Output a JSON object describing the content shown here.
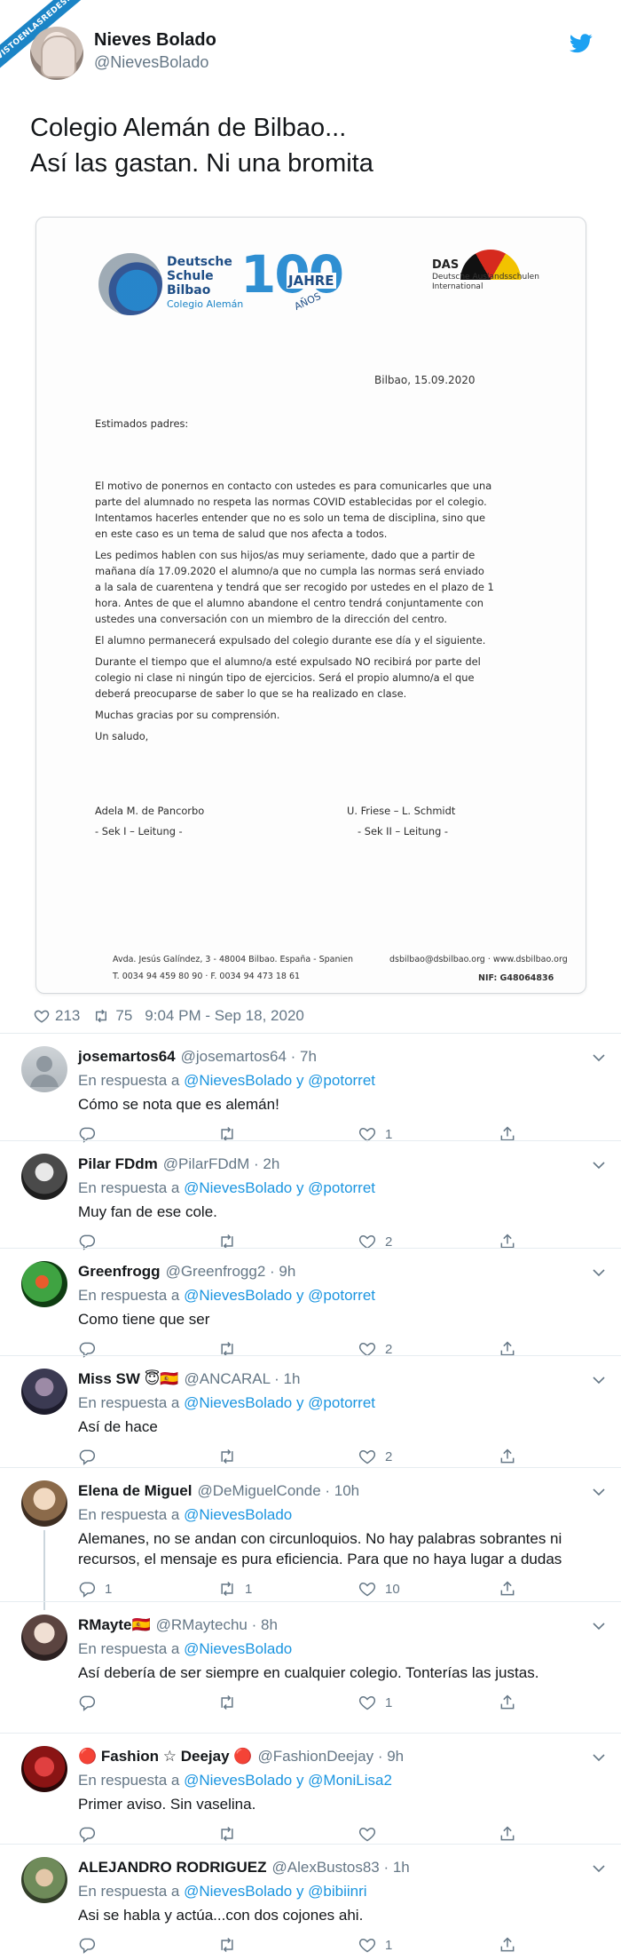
{
  "watermark": "VISTOENLASREDES.COM",
  "tweet": {
    "author_name": "Nieves Bolado",
    "author_handle": "@NievesBolado",
    "text_lines": [
      "Colegio Alemán de Bilbao...",
      "Así las gastan. Ni una bromita"
    ],
    "likes": "213",
    "retweets": "75",
    "timestamp": "9:04 PM - Sep 18, 2020"
  },
  "letter": {
    "school_lines": [
      "Deutsche",
      "Schule",
      "Bilbao"
    ],
    "school_sub": "Colegio Alemán",
    "jubilee_number": "100",
    "jubilee_word": "JAHRE",
    "jubilee_sub": "AÑOS",
    "das_title": "DAS",
    "das_sub_lines": [
      "Deutsche Auslandsschulen",
      "International"
    ],
    "date": "Bilbao, 15.09.2020",
    "greeting": "Estimados padres:",
    "paragraph_lines": [
      "El motivo de ponernos en contacto con ustedes es para comunicarles que una",
      "parte del alumnado no respeta las normas COVID establecidas por el colegio.",
      "Intentamos hacerles entender que no es solo un tema de disciplina, sino que",
      "en este caso es un tema de salud que nos afecta a todos.",
      "Les pedimos hablen con sus hijos/as muy seriamente, dado que a partir de",
      "mañana día 17.09.2020 el alumno/a que no cumpla las normas será enviado",
      "a la sala de cuarentena y tendrá que ser recogido por ustedes en el plazo de 1",
      "hora. Antes de que el alumno abandone el centro tendrá conjuntamente con",
      "ustedes una conversación con un miembro de la dirección del centro.",
      "El alumno permanecerá expulsado del colegio durante ese día y el siguiente.",
      "Durante el tiempo que el alumno/a esté expulsado NO recibirá por parte del",
      "colegio ni clase ni ningún tipo de ejercicios. Será el propio alumno/a el que",
      "deberá preocuparse de saber lo que se ha realizado en clase.",
      "Muchas gracias por su comprensión.",
      "Un saludo,"
    ],
    "signer_left_name": "Adela M. de Pancorbo",
    "signer_left_role": "- Sek I – Leitung -",
    "signer_right_name": "U. Friese – L. Schmidt",
    "signer_right_role": "- Sek II – Leitung -",
    "footer_address": "Avda. Jesús Galíndez, 3 - 48004 Bilbao. España - Spanien",
    "footer_phones": "T. 0034 94 459 80 90 · F. 0034 94 473 18 61",
    "footer_web": "dsbilbao@dsbilbao.org · www.dsbilbao.org",
    "footer_nif": "NIF: G48064836"
  },
  "replies": [
    {
      "name": "josemartos64",
      "handle": "@josemartos64 · 7h",
      "in_reply_prefix": "En respuesta a ",
      "mentions": "@NievesBolado y @potorret",
      "text": "Cómo se nota que es alemán!",
      "reply_count": "",
      "retweet_count": "",
      "like_count": "1"
    },
    {
      "name": "Pilar FDdm",
      "handle": "@PilarFDdM · 2h",
      "in_reply_prefix": "En respuesta a ",
      "mentions": "@NievesBolado y @potorret",
      "text": "Muy fan de ese cole.",
      "reply_count": "",
      "retweet_count": "",
      "like_count": "2"
    },
    {
      "name": "Greenfrogg",
      "handle": "@Greenfrogg2 · 9h",
      "in_reply_prefix": "En respuesta a ",
      "mentions": "@NievesBolado y @potorret",
      "text": "Como tiene que ser",
      "reply_count": "",
      "retweet_count": "",
      "like_count": "2"
    },
    {
      "name": "Miss SW 😇🇪🇸",
      "handle": "@ANCARAL · 1h",
      "in_reply_prefix": "En respuesta a ",
      "mentions": "@NievesBolado y @potorret",
      "text": "Así de hace",
      "reply_count": "",
      "retweet_count": "",
      "like_count": "2"
    },
    {
      "name": "Elena de Miguel",
      "handle": "@DeMiguelConde · 10h",
      "in_reply_prefix": "En respuesta a ",
      "mentions": "@NievesBolado",
      "text": "Alemanes, no se andan con circunloquios. No hay palabras sobrantes ni recursos, el mensaje es pura eficiencia. Para que no haya lugar a dudas",
      "reply_count": "1",
      "retweet_count": "1",
      "like_count": "10"
    },
    {
      "name": "RMayte🇪🇸",
      "handle": "@RMaytechu · 8h",
      "in_reply_prefix": "En respuesta a ",
      "mentions": "@NievesBolado",
      "text": "Así debería de ser siempre en cualquier colegio. Tonterías las justas.",
      "reply_count": "",
      "retweet_count": "",
      "like_count": "1"
    },
    {
      "name": "🔴 Fashion ☆ Deejay 🔴",
      "handle": "@FashionDeejay · 9h",
      "in_reply_prefix": "En respuesta a ",
      "mentions": "@NievesBolado y @MoniLisa2",
      "text": "Primer aviso. Sin vaselina.",
      "reply_count": "",
      "retweet_count": "",
      "like_count": ""
    },
    {
      "name": "ALEJANDRO RODRIGUEZ",
      "handle": "@AlexBustos83 · 1h",
      "in_reply_prefix": "En respuesta a ",
      "mentions": "@NievesBolado y @bibiinri",
      "text": "Asi se habla y actúa...con dos cojones ahi.",
      "reply_count": "",
      "retweet_count": "",
      "like_count": "1"
    }
  ],
  "colors": {
    "accent": "#1b95e0",
    "muted": "#657786",
    "text": "#14171a",
    "divider": "#e6ecf0"
  }
}
